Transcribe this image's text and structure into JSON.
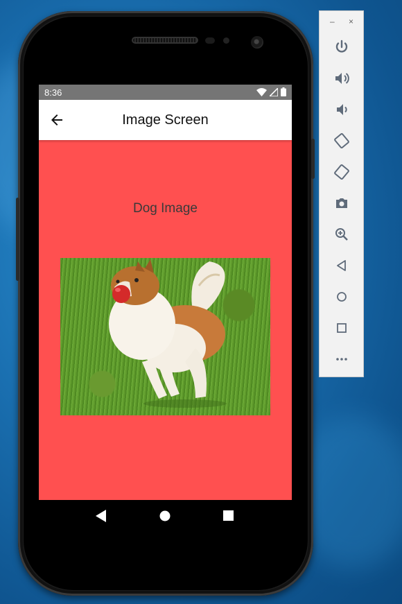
{
  "status_bar": {
    "time": "8:36",
    "icons": [
      "wifi-icon",
      "cell-signal-icon",
      "battery-icon"
    ]
  },
  "app_bar": {
    "title": "Image Screen",
    "back_icon": "arrow-back-icon"
  },
  "content": {
    "caption": "Dog Image",
    "background_color": "#ff5050",
    "image_subject": "collie dog with red ball on grass"
  },
  "nav_bar": {
    "buttons": [
      "back-triangle-icon",
      "home-circle-icon",
      "recents-square-icon"
    ]
  },
  "emulator_toolbar": {
    "window_controls": {
      "minimize": "–",
      "close": "×"
    },
    "items": [
      "power-icon",
      "volume-up-icon",
      "volume-down-icon",
      "rotate-left-icon",
      "rotate-right-icon",
      "camera-icon",
      "zoom-icon",
      "back-icon",
      "home-icon",
      "overview-icon",
      "more-icon"
    ]
  },
  "colors": {
    "screen_bg": "#ff5050",
    "status_bar": "#757575",
    "app_bar": "#ffffff",
    "toolbar_icon": "#5f6b7a"
  }
}
